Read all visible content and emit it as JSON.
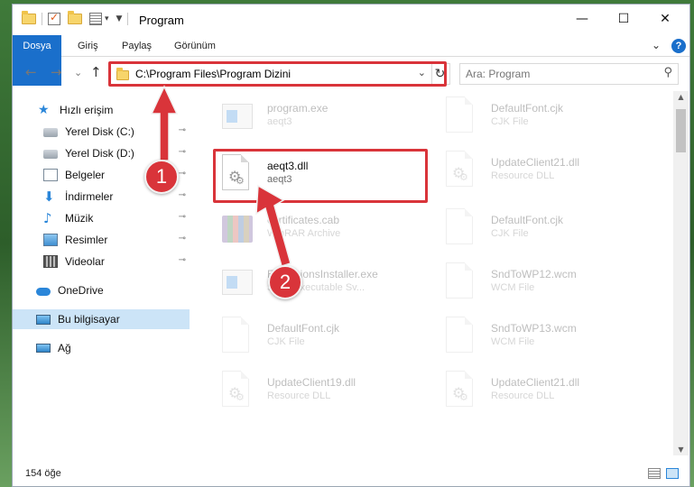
{
  "window": {
    "title": "Program"
  },
  "titlebar": {
    "minimize_glyph": "—",
    "maximize_glyph": "☐",
    "close_glyph": "✕"
  },
  "ribbon": {
    "tabs": [
      "Dosya",
      "Giriş",
      "Paylaş",
      "Görünüm"
    ],
    "expand_glyph": "⌄",
    "help_glyph": "?"
  },
  "nav": {
    "back_glyph": "←",
    "forward_glyph": "→",
    "recent_glyph": "⌄",
    "up_glyph": "↑",
    "address": "C:\\Program Files\\Program Dizini",
    "address_dropdown_glyph": "⌄",
    "refresh_glyph": "↻",
    "search_placeholder": "Ara: Program",
    "search_glyph": "⚲"
  },
  "sidebar": {
    "items": [
      {
        "label": "Hızlı erişim",
        "icon": "star-icon",
        "pinned": false
      },
      {
        "label": "Yerel Disk (C:)",
        "icon": "drive-icon",
        "pinned": true
      },
      {
        "label": "Yerel Disk (D:)",
        "icon": "drive-icon",
        "pinned": true
      },
      {
        "label": "Belgeler",
        "icon": "document-icon",
        "pinned": true
      },
      {
        "label": "İndirmeler",
        "icon": "download-icon",
        "pinned": true
      },
      {
        "label": "Müzik",
        "icon": "music-icon",
        "pinned": true
      },
      {
        "label": "Resimler",
        "icon": "pictures-icon",
        "pinned": true
      },
      {
        "label": "Videolar",
        "icon": "video-icon",
        "pinned": true
      },
      {
        "label": "OneDrive",
        "icon": "cloud-icon",
        "pinned": false
      },
      {
        "label": "Bu bilgisayar",
        "icon": "computer-icon",
        "pinned": false,
        "selected": true
      },
      {
        "label": "Ağ",
        "icon": "network-icon",
        "pinned": false
      }
    ],
    "pin_glyph": "📌"
  },
  "files": {
    "left": [
      {
        "name": "program.exe",
        "type": "aeqt3",
        "icon": "exe-icon",
        "faded": true
      },
      {
        "name": "aeqt3.dll",
        "type": "aeqt3",
        "icon": "dll-icon",
        "faded": false
      },
      {
        "name": "certificates.cab",
        "type": "WinRAR Archive",
        "icon": "archive-icon",
        "faded": true
      },
      {
        "name": "ExtensionsInstaller.exe",
        "type": "SmartExecutable Sv...",
        "icon": "exe-icon",
        "faded": true
      },
      {
        "name": "DefaultFont.cjk",
        "type": "CJK File",
        "icon": "file-icon",
        "faded": true
      },
      {
        "name": "UpdateClient19.dll",
        "type": "Resource DLL",
        "icon": "dll-icon",
        "faded": true
      }
    ],
    "right": [
      {
        "name": "DefaultFont.cjk",
        "type": "CJK File",
        "icon": "file-icon",
        "faded": true
      },
      {
        "name": "UpdateClient21.dll",
        "type": "Resource DLL",
        "icon": "dll-icon",
        "faded": true
      },
      {
        "name": "DefaultFont.cjk",
        "type": "CJK File",
        "icon": "file-icon",
        "faded": true
      },
      {
        "name": "SndToWP12.wcm",
        "type": "WCM File",
        "icon": "file-icon",
        "faded": true
      },
      {
        "name": "SndToWP13.wcm",
        "type": "WCM File",
        "icon": "file-icon",
        "faded": true
      },
      {
        "name": "UpdateClient21.dll",
        "type": "Resource DLL",
        "icon": "dll-icon",
        "faded": true
      }
    ]
  },
  "scrollbar": {
    "up_glyph": "▲",
    "down_glyph": "▼"
  },
  "status": {
    "count": "154 öğe"
  },
  "annotations": {
    "badge_1": "1",
    "badge_2": "2",
    "accent_color": "#d9343a"
  }
}
